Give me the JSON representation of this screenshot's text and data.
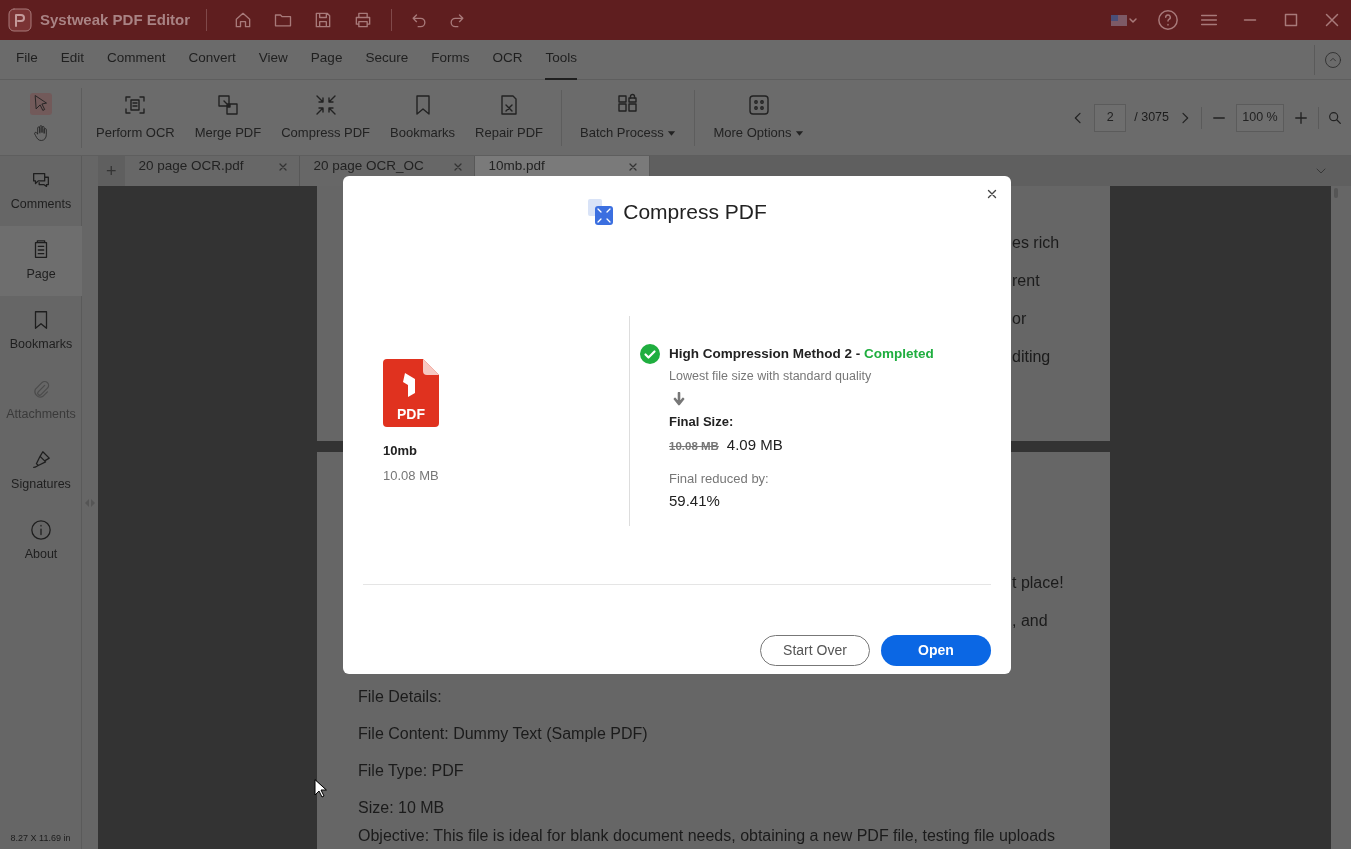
{
  "window": {
    "title": "Systweak PDF Editor"
  },
  "menu": [
    {
      "label": "File",
      "selected": false
    },
    {
      "label": "Edit",
      "selected": false
    },
    {
      "label": "Comment",
      "selected": false
    },
    {
      "label": "Convert",
      "selected": false
    },
    {
      "label": "View",
      "selected": false
    },
    {
      "label": "Page",
      "selected": false
    },
    {
      "label": "Secure",
      "selected": false
    },
    {
      "label": "Forms",
      "selected": false
    },
    {
      "label": "OCR",
      "selected": false
    },
    {
      "label": "Tools",
      "selected": true
    }
  ],
  "tools": [
    {
      "label": "Perform OCR",
      "dropdown": false
    },
    {
      "label": "Merge PDF",
      "dropdown": false
    },
    {
      "label": "Compress PDF",
      "dropdown": false
    },
    {
      "label": "Bookmarks",
      "dropdown": false
    },
    {
      "label": "Repair PDF",
      "dropdown": false
    },
    {
      "label": "Batch Process",
      "dropdown": true
    },
    {
      "label": "More Options",
      "dropdown": true
    }
  ],
  "page_nav": {
    "current": "2",
    "total": "/ 3075",
    "zoom": "100 %"
  },
  "new_tab": "+",
  "tabs": [
    {
      "label": "20 page OCR.pdf",
      "selected": false
    },
    {
      "label": "20 page OCR_OC",
      "selected": false
    },
    {
      "label": "10mb.pdf",
      "selected": true
    }
  ],
  "sidebar": [
    {
      "label": "Comments",
      "selected": false,
      "disabled": false
    },
    {
      "label": "Page",
      "selected": true,
      "disabled": false
    },
    {
      "label": "Bookmarks",
      "selected": false,
      "disabled": false
    },
    {
      "label": "Attachments",
      "selected": false,
      "disabled": true
    },
    {
      "label": "Signatures",
      "selected": false,
      "disabled": false
    },
    {
      "label": "About",
      "selected": false,
      "disabled": false
    }
  ],
  "status_bar": {
    "page_size": "8.27 X 11.69 in"
  },
  "document": {
    "page_1_fragments": [
      "es rich",
      "rent",
      "or",
      "diting"
    ],
    "page_2_fragments": [
      "t place!",
      ", and"
    ],
    "page_2_lines": [
      "File Details:",
      "File Content: Dummy Text (Sample PDF)",
      "File Type: PDF",
      "Size: 10 MB",
      "Objective: This file is ideal for blank document needs, obtaining a new PDF file, testing file uploads"
    ]
  },
  "dialog": {
    "title": "Compress PDF",
    "file_badge": "PDF",
    "file_name": "10mb",
    "file_size": "10.08 MB",
    "method": "High Compression Method 2 - ",
    "status": "Completed",
    "description": "Lowest file size with standard quality",
    "final_size_label": "Final Size:",
    "old_size": "10.08 MB",
    "new_size": "4.09 MB",
    "reduced_label": "Final reduced by:",
    "reduced_value": "59.41%",
    "buttons": [
      {
        "label": "Start Over",
        "kind": "secondary"
      },
      {
        "label": "Open",
        "kind": "primary"
      }
    ]
  }
}
